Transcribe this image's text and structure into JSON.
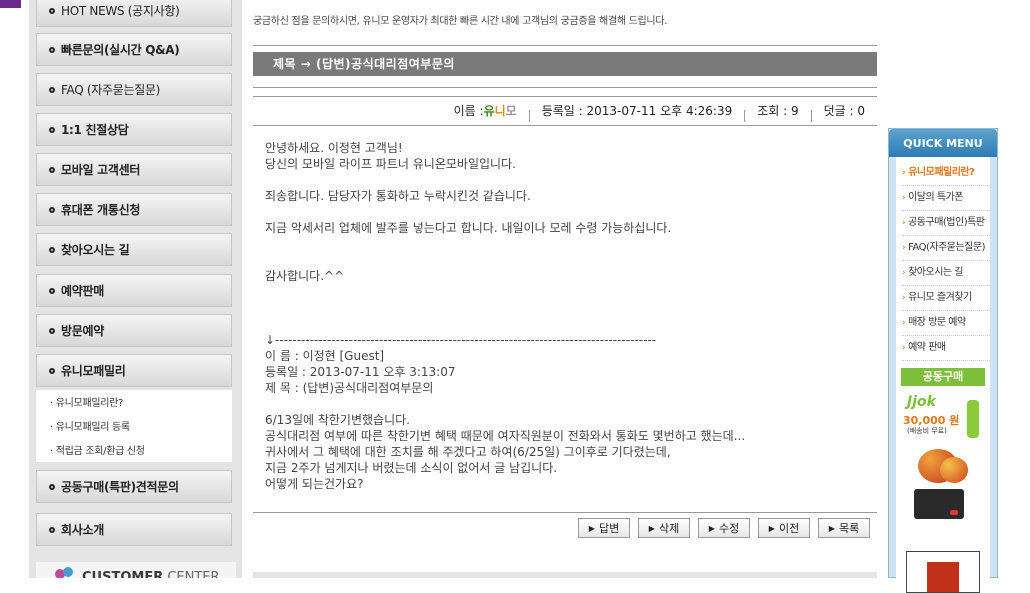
{
  "left_menu": {
    "items": [
      {
        "label": "HOT NEWS (공지사항)"
      },
      {
        "label": "빠른문의(실시간 Q&A)"
      },
      {
        "label": "FAQ (자주묻는질문)"
      },
      {
        "label": "1:1 친절상담"
      },
      {
        "label": "모바일 고객센터"
      },
      {
        "label": "휴대폰 개통신청"
      },
      {
        "label": "찾아오시는 길"
      },
      {
        "label": "예약판매"
      },
      {
        "label": "방문예약"
      },
      {
        "label": "유니모패밀리"
      },
      {
        "label": "공동구매(특판)견적문의"
      },
      {
        "label": "회사소개"
      }
    ],
    "sub_items": [
      {
        "label": "· 유니모패밀리란?"
      },
      {
        "label": "· 유니모패밀리 등록"
      },
      {
        "label": "· 적립금 조회/환급 신청"
      }
    ],
    "customer_center": {
      "bold": "CUSTOMER",
      "light": " CENTER"
    }
  },
  "intro_text": "궁금하신 점을 문의하시면, 유니모 운영자가 최대한 빠른 시간 내에 고객님의 궁금증을 해결해 드립니다.",
  "post": {
    "title": "제목 → (답변)공식대리점여부문의",
    "meta": {
      "author_label": "이름 : ",
      "author_u": "유",
      "author_ni": "니",
      "author_mo": "모",
      "date": "등록일 : 2013-07-11 오후 4:26:39",
      "views": "조회 : 9",
      "comments": "덧글 : 0"
    },
    "body": "안녕하세요. 이정현 고객님!\n당신의 모바일 라이프 파트너 유니온모바일입니다.\n\n죄송합니다. 담당자가 통화하고 누락시킨것 같습니다.\n\n지금 악세서리 업체에 발주를 넣는다고 합니다. 내일이나 모레 수령 가능하십니다.\n\n\n감사합니다.^^\n\n\n\n↓----------------------------------------------------------------------------------------\n이 름 : 이정현 [Guest]\n등록일 : 2013-07-11 오후 3:13:07\n제 목 : (답변)공식대리점여부문의\n\n6/13일에 착한기변했습니다.\n공식대리점 여부에 따른 착한기변 혜택 때문에 여자직원분이 전화와서 통화도 몇번하고 했는데...\n귀사에서 그 혜택에 대한 조치를 해 주겠다고 하여(6/25일) 그이후로 기다렸는데,\n지금 2주가 넘게지나 버렸는데 소식이 없어서 글 남깁니다.\n어떻게 되는건가요?"
  },
  "buttons": [
    {
      "label": "답변"
    },
    {
      "label": "삭제"
    },
    {
      "label": "수정"
    },
    {
      "label": "이전"
    },
    {
      "label": "목록"
    }
  ],
  "quick_menu": {
    "title": "QUICK MENU",
    "items": [
      {
        "label": "유니모패밀리란?"
      },
      {
        "label": "이달의 특가폰"
      },
      {
        "label": "공동구매(법인)특판"
      },
      {
        "label": "FAQ(자주묻는질문)"
      },
      {
        "label": "찾아오시는 길"
      },
      {
        "label": "유니모 즐겨찾기"
      },
      {
        "label": "매장 방문 예약"
      },
      {
        "label": "예약 판매"
      }
    ],
    "group_buy": "공동구매",
    "promo_price": "30,000 원",
    "promo_sub": "(배송비 무료)",
    "promo_logo": "Jjok"
  },
  "colors": {
    "title_bar": "#7a7a7a",
    "accent_orange": "#e0771a",
    "accent_green": "#7dbe3a",
    "quick_blue": "#2c7bb2"
  }
}
